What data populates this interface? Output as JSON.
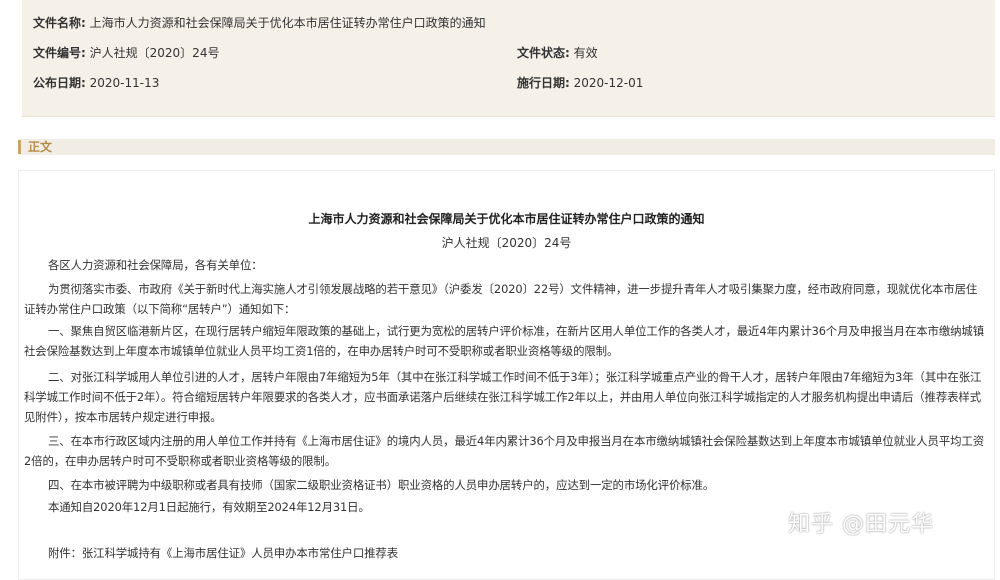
{
  "meta": {
    "file_name_label": "文件名称:",
    "file_name_value": "上海市人力资源和社会保障局关于优化本市居住证转办常住户口政策的通知",
    "file_no_label": "文件编号:",
    "file_no_value": "沪人社规〔2020〕24号",
    "file_status_label": "文件状态:",
    "file_status_value": "有效",
    "publish_date_label": "公布日期:",
    "publish_date_value": "2020-11-13",
    "effective_date_label": "施行日期:",
    "effective_date_value": "2020-12-01"
  },
  "section": {
    "title": "正文"
  },
  "document": {
    "title": "上海市人力资源和社会保障局关于优化本市居住证转办常住户口政策的通知",
    "number": "沪人社规〔2020〕24号",
    "paragraphs": [
      "各区人力资源和社会保障局，各有关单位：",
      "为贯彻落实市委、市政府《关于新时代上海实施人才引领发展战略的若干意见》（沪委发〔2020〕22号）文件精神，进一步提升青年人才吸引集聚力度，经市政府同意，现就优化本市居住证转办常住户口政策（以下简称“居转户”）通知如下：",
      "一、聚焦自贸区临港新片区，在现行居转户缩短年限政策的基础上，试行更为宽松的居转户评价标准，在新片区用人单位工作的各类人才，最近4年内累计36个月及申报当月在本市缴纳城镇社会保险基数达到上年度本市城镇单位就业人员平均工资1倍的，在申办居转户时可不受职称或者职业资格等级的限制。",
      "二、对张江科学城用人单位引进的人才，居转户年限由7年缩短为5年（其中在张江科学城工作时间不低于3年）；张江科学城重点产业的骨干人才，居转户年限由7年缩短为3年（其中在张江科学城工作时间不低于2年）。符合缩短居转户年限要求的各类人才，应书面承诺落户后继续在张江科学城工作2年以上，并由用人单位向张江科学城指定的人才服务机构提出申请后（推荐表样式见附件），按本市居转户规定进行申报。",
      "三、在本市行政区域内注册的用人单位工作并持有《上海市居住证》的境内人员，最近4年内累计36个月及申报当月在本市缴纳城镇社会保险基数达到上年度本市城镇单位就业人员平均工资2倍的，在申办居转户时可不受职称或者职业资格等级的限制。",
      "四、在本市被评聘为中级职称或者具有技师（国家二级职业资格证书）职业资格的人员申办居转户的，应达到一定的市场化评价标准。",
      "本通知自2020年12月1日起施行，有效期至2024年12月31日。",
      "附件：张江科学城持有《上海市居住证》人员申办本市常住户口推荐表"
    ]
  },
  "watermark": {
    "text": "知乎 @田元华"
  }
}
